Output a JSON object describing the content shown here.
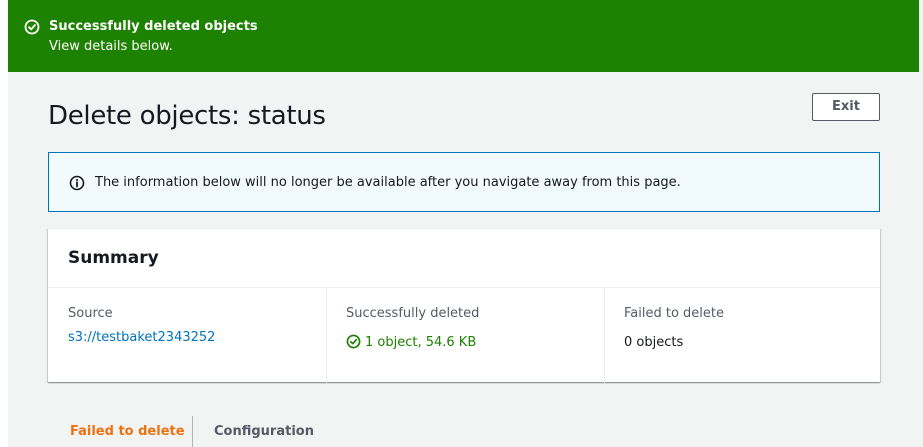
{
  "flash": {
    "title": "Successfully deleted objects",
    "subtitle": "View details below.",
    "icon": "check-circle-icon",
    "color": "#1d8102"
  },
  "header": {
    "title": "Delete objects: status",
    "exit_label": "Exit"
  },
  "info_alert": {
    "icon": "info-icon",
    "text": "The information below will no longer be available after you navigate away from this page."
  },
  "summary": {
    "title": "Summary",
    "source_label": "Source",
    "source_value": "s3://testbaket2343252",
    "success_label": "Successfully deleted",
    "success_value": "1 object, 54.6 KB",
    "failed_label": "Failed to delete",
    "failed_value": "0 objects"
  },
  "tabs": [
    {
      "label": "Failed to delete",
      "active": true
    },
    {
      "label": "Configuration",
      "active": false
    }
  ],
  "colors": {
    "success": "#1d8102",
    "link": "#0073bb",
    "info_border": "#0073bb",
    "active_tab": "#ec7211"
  }
}
